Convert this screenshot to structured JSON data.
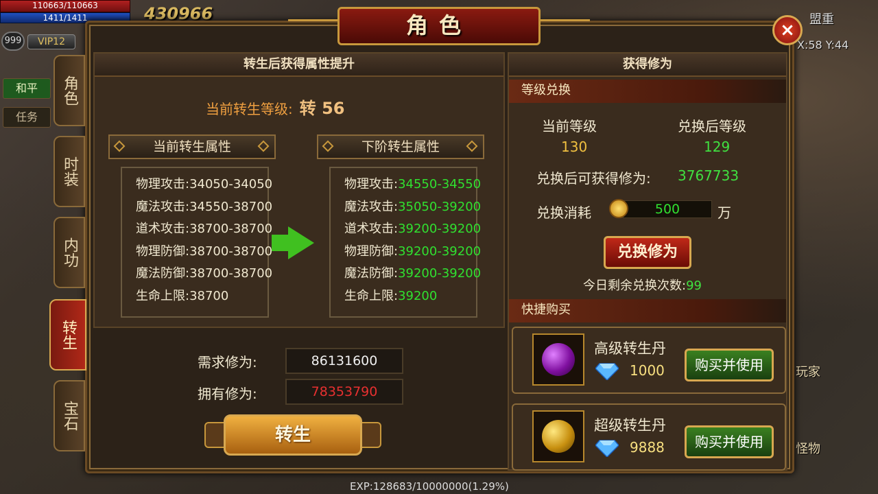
{
  "hud": {
    "hp": "110663/110663",
    "mp": "1411/1411",
    "level": "999",
    "vip": "VIP12",
    "score": "430966",
    "peace_btn": "和平",
    "task_btn": "任务",
    "coords": "X:58 Y:44",
    "alliance": "盟重",
    "exp": "EXP:128683/10000000(1.29%)",
    "player_label": "玩家",
    "monster_label": "怪物"
  },
  "side_tabs": [
    {
      "label": "角色"
    },
    {
      "label": "时装"
    },
    {
      "label": "内功"
    },
    {
      "label": "转生"
    },
    {
      "label": "宝石"
    }
  ],
  "title": "角色",
  "close_label": "×",
  "left_panel": {
    "header": "转生后获得属性提升",
    "current_level_label": "当前转生等级:",
    "current_level_value": "转 56",
    "current_title": "当前转生属性",
    "next_title": "下阶转生属性",
    "current_attrs": [
      {
        "label": "物理攻击:",
        "value": "34050-34050"
      },
      {
        "label": "魔法攻击:",
        "value": "34550-38700"
      },
      {
        "label": "道术攻击:",
        "value": "38700-38700"
      },
      {
        "label": "物理防御:",
        "value": "38700-38700"
      },
      {
        "label": "魔法防御:",
        "value": "38700-38700"
      },
      {
        "label": "生命上限:",
        "value": "38700"
      }
    ],
    "next_attrs": [
      {
        "label": "物理攻击:",
        "value": "34550-34550"
      },
      {
        "label": "魔法攻击:",
        "value": "35050-39200"
      },
      {
        "label": "道术攻击:",
        "value": "39200-39200"
      },
      {
        "label": "物理防御:",
        "value": "39200-39200"
      },
      {
        "label": "魔法防御:",
        "value": "39200-39200"
      },
      {
        "label": "生命上限:",
        "value": "39200"
      }
    ],
    "required_label": "需求修为:",
    "required_value": "86131600",
    "owned_label": "拥有修为:",
    "owned_value": "78353790",
    "rebirth_btn": "转生"
  },
  "right_panel": {
    "header": "获得修为",
    "exchange_section": "等级兑换",
    "current_level_label": "当前等级",
    "after_level_label": "兑换后等级",
    "current_level": "130",
    "after_level": "129",
    "obtain_label": "兑换后可获得修为:",
    "obtain_value": "3767733",
    "cost_label": "兑换消耗",
    "cost_value": "500",
    "cost_unit": "万",
    "exchange_btn": "兑换修为",
    "remaining_label": "今日剩余兑换次数:",
    "remaining_value": "99",
    "shop_section": "快捷购买",
    "items": [
      {
        "name": "高级转生丹",
        "price": "1000",
        "buy": "购买并使用"
      },
      {
        "name": "超级转生丹",
        "price": "9888",
        "buy": "购买并使用"
      }
    ]
  }
}
